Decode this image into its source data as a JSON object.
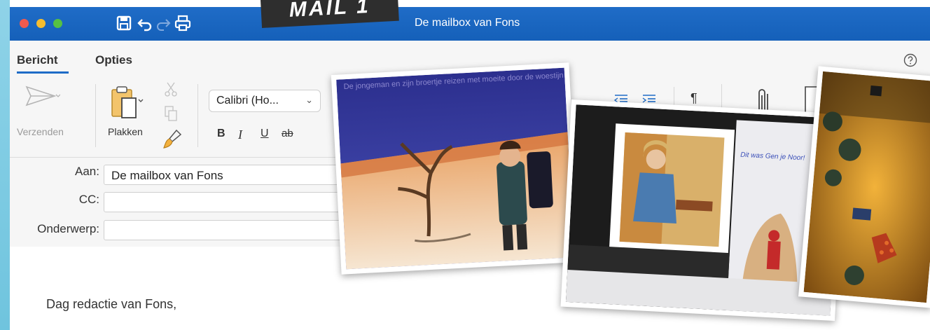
{
  "window": {
    "title": "De mailbox van Fons",
    "sticker": "MAIL 1",
    "traffic_lights": [
      "close",
      "minimize",
      "zoom"
    ],
    "toolbar_icons": [
      "save-icon",
      "undo-icon",
      "redo-icon",
      "print-icon"
    ],
    "accent": "#1f6cc7"
  },
  "ribbon": {
    "tabs": [
      {
        "label": "Bericht",
        "active": true
      },
      {
        "label": "Opties",
        "active": false
      }
    ],
    "help_icon": "question-circle-icon",
    "send_label": "Verzenden",
    "paste_label": "Plakken",
    "font_name": "Calibri (Ho...",
    "format_buttons": {
      "bold": "B",
      "italic": "I",
      "underline": "U",
      "strike": "ab"
    },
    "pilcrow": "¶"
  },
  "address": {
    "to_label": "Aan:",
    "to_value": "De mailbox van Fons",
    "cc_label": "CC:",
    "cc_value": "",
    "subject_label": "Onderwerp:",
    "subject_value": ""
  },
  "body": {
    "greeting": "Dag redactie van Fons,"
  },
  "photos": {
    "photo1_caption": "De jongeman en zijn broertje reizen met moeite door de woestijn van hun land.",
    "photo2_note": "Dit was Gen je Noor!"
  }
}
